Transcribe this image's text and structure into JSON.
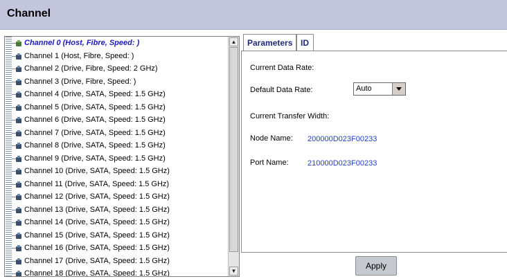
{
  "header": {
    "title": "Channel"
  },
  "channels": [
    "Channel 0 (Host, Fibre, Speed: )",
    "Channel 1 (Host, Fibre, Speed: )",
    "Channel 2 (Drive, Fibre, Speed: 2 GHz)",
    "Channel 3 (Drive, Fibre, Speed: )",
    "Channel 4 (Drive, SATA, Speed: 1.5 GHz)",
    "Channel 5 (Drive, SATA, Speed: 1.5 GHz)",
    "Channel 6 (Drive, SATA, Speed: 1.5 GHz)",
    "Channel 7 (Drive, SATA, Speed: 1.5 GHz)",
    "Channel 8 (Drive, SATA, Speed: 1.5 GHz)",
    "Channel 9 (Drive, SATA, Speed: 1.5 GHz)",
    "Channel 10 (Drive, SATA, Speed: 1.5 GHz)",
    "Channel 11 (Drive, SATA, Speed: 1.5 GHz)",
    "Channel 12 (Drive, SATA, Speed: 1.5 GHz)",
    "Channel 13 (Drive, SATA, Speed: 1.5 GHz)",
    "Channel 14 (Drive, SATA, Speed: 1.5 GHz)",
    "Channel 15 (Drive, SATA, Speed: 1.5 GHz)",
    "Channel 16 (Drive, SATA, Speed: 1.5 GHz)",
    "Channel 17 (Drive, SATA, Speed: 1.5 GHz)",
    "Channel 18 (Drive, SATA, Speed: 1.5 GHz)"
  ],
  "selected_index": 0,
  "tabs": {
    "parameters": "Parameters",
    "id": "ID"
  },
  "panel": {
    "current_data_rate_label": "Current Data Rate:",
    "default_data_rate_label": "Default Data Rate:",
    "default_data_rate_value": "Auto",
    "current_transfer_width_label": "Current Transfer Width:",
    "node_name_label": "Node Name:",
    "node_name_value": "200000D023F00233",
    "port_name_label": "Port Name:",
    "port_name_value": "210000D023F00233"
  },
  "apply_label": "Apply",
  "colors": {
    "header_bg": "#c4c6de",
    "value_blue": "#1f3fc0",
    "selected_text": "#1a1ab8"
  }
}
